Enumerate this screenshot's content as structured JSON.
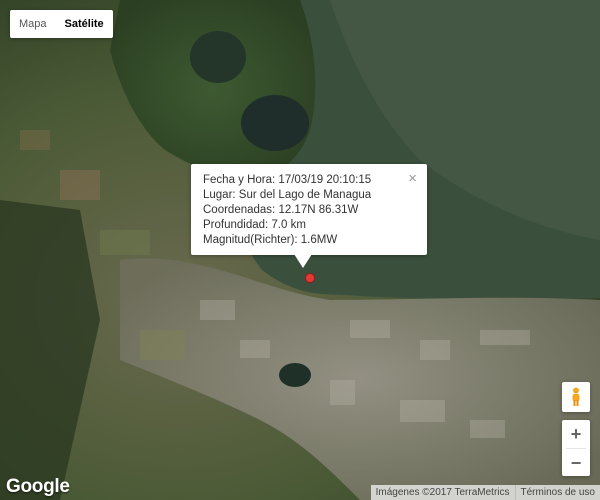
{
  "map_type": {
    "options": [
      "Mapa",
      "Satélite"
    ],
    "selected": "Satélite"
  },
  "info_window": {
    "lines": [
      "Fecha y Hora: 17/03/19 20:10:15",
      "Lugar: Sur del Lago de Managua",
      "Coordenadas: 12.17N 86.31W",
      "Profundidad: 7.0 km",
      "Magnitud(Richter): 1.6MW"
    ],
    "close_label": "×"
  },
  "controls": {
    "zoom_in_label": "+",
    "zoom_out_label": "−"
  },
  "footer": {
    "logo": "Google",
    "attribution": "Imágenes ©2017 TerraMetrics",
    "terms": "Términos de uso"
  },
  "colors": {
    "marker": "#e53935",
    "pegman": "#f5a623"
  }
}
